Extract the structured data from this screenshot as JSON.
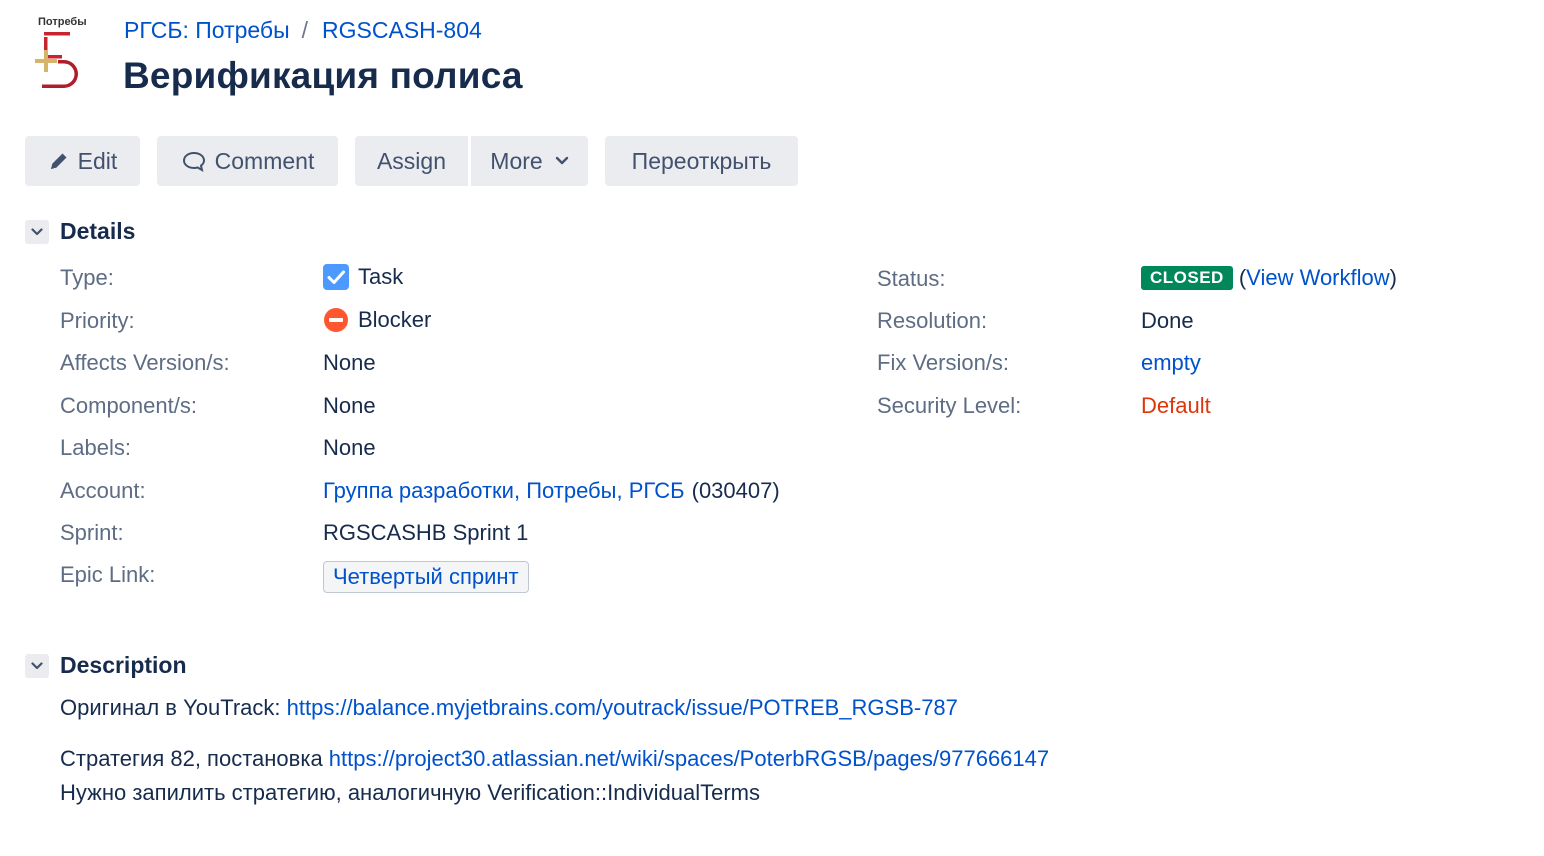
{
  "project": {
    "logo_text": "Потребы",
    "name": "РГСБ: Потребы",
    "issue_key": "RGSCASH-804"
  },
  "issue": {
    "title": "Верификация полиса"
  },
  "toolbar": {
    "edit_label": "Edit",
    "comment_label": "Comment",
    "assign_label": "Assign",
    "more_label": "More",
    "reopen_label": "Переоткрыть"
  },
  "details": {
    "title": "Details",
    "type": {
      "label": "Type:",
      "value": "Task"
    },
    "priority": {
      "label": "Priority:",
      "value": "Blocker"
    },
    "affects_versions": {
      "label": "Affects Version/s:",
      "value": "None"
    },
    "components": {
      "label": "Component/s:",
      "value": "None"
    },
    "labels": {
      "label": "Labels:",
      "value": "None"
    },
    "account": {
      "label": "Account:",
      "value": "Группа разработки, Потребы, РГСБ",
      "code": "(030407)"
    },
    "sprint": {
      "label": "Sprint:",
      "value": "RGSCASHB Sprint 1"
    },
    "epic_link": {
      "label": "Epic Link:",
      "value": "Четвертый спринт"
    },
    "status": {
      "label": "Status:",
      "value": "CLOSED",
      "paren_open": "(",
      "workflow_link": "View Workflow",
      "paren_close": ")"
    },
    "resolution": {
      "label": "Resolution:",
      "value": "Done"
    },
    "fix_versions": {
      "label": "Fix Version/s:",
      "value": "empty"
    },
    "security_level": {
      "label": "Security Level:",
      "value": "Default"
    }
  },
  "description": {
    "title": "Description",
    "line1_prefix": "Оригинал в YouTrack: ",
    "line1_link": "https://balance.myjetbrains.com/youtrack/issue/POTREB_RGSB-787",
    "line2_prefix": "Стратегия 82, постановка ",
    "line2_link": "https://project30.atlassian.net/wiki/spaces/PoterbRGSB/pages/977666147",
    "line3": "Нужно запилить стратегию, аналогичную Verification::IndividualTerms"
  },
  "colors": {
    "link": "#0052cc",
    "status_closed": "#00875a",
    "security_default": "#de350b",
    "priority_blocker": "#ff5630",
    "task_icon": "#4c9aff"
  }
}
